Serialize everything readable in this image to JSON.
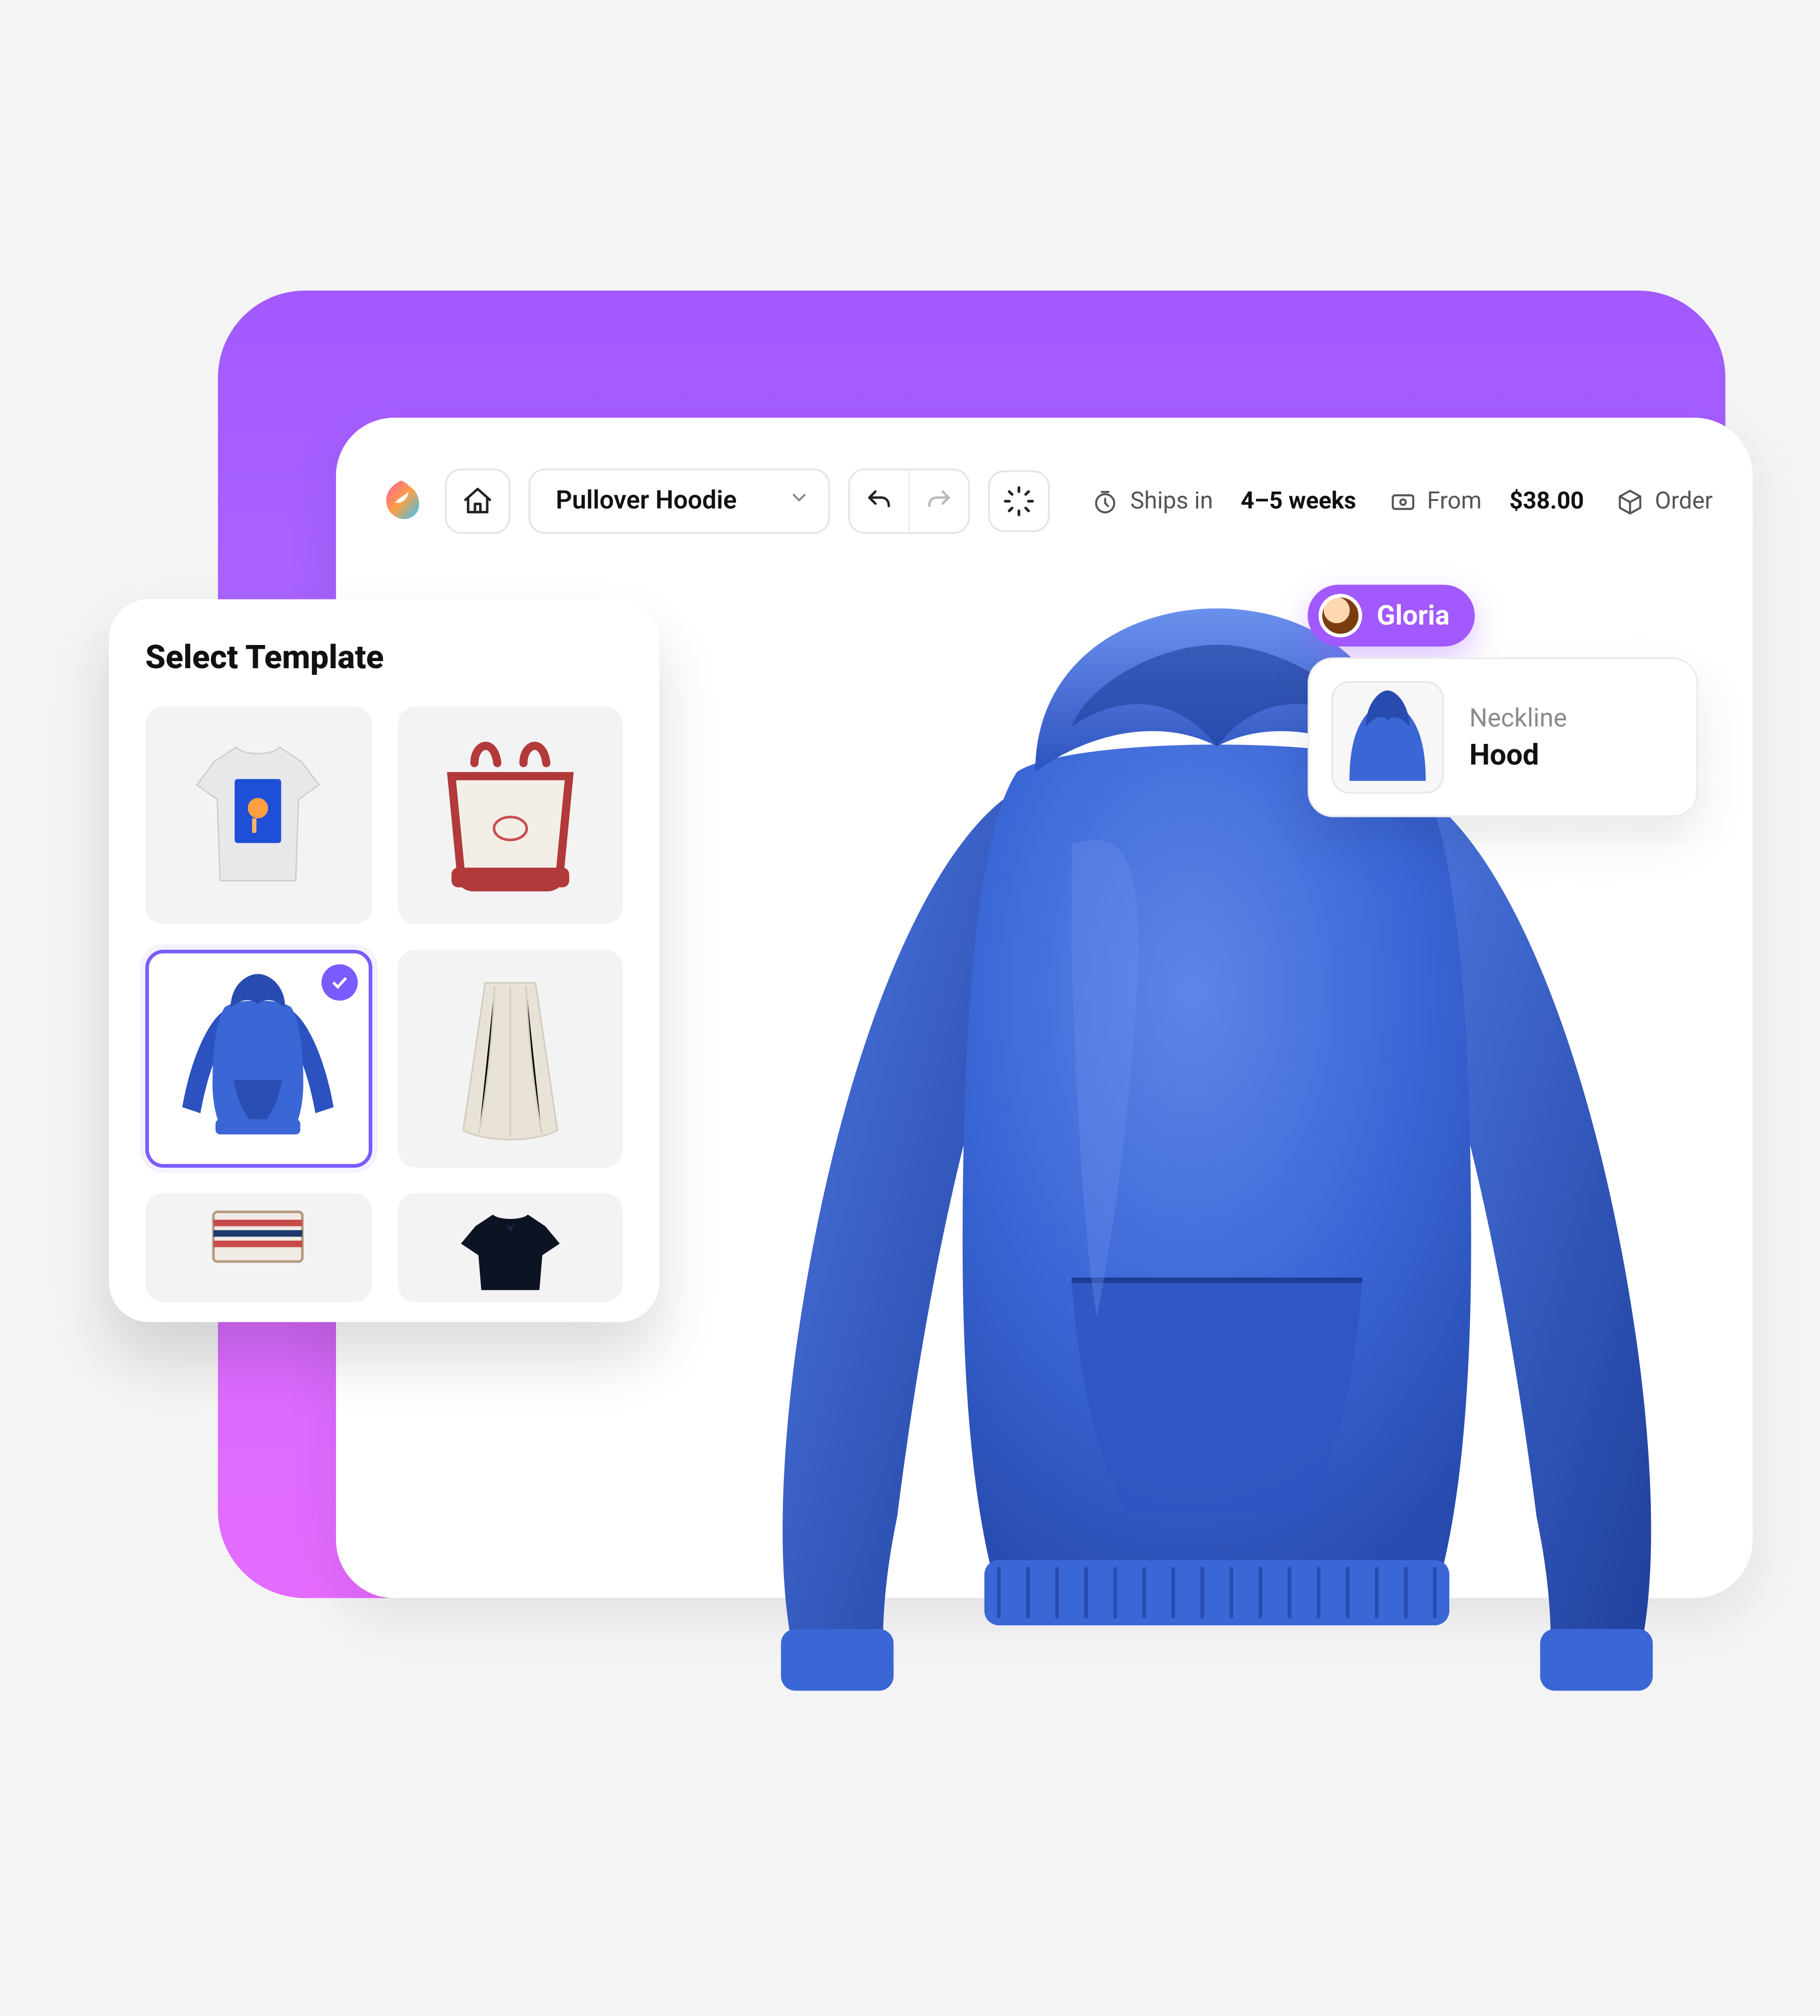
{
  "header": {
    "product_name": "Pullover Hoodie",
    "shipping_prefix": "Ships in",
    "shipping_value": "4–5 weeks",
    "price_prefix": "From",
    "price_value": "$38.00",
    "order_label": "Order"
  },
  "collaborator": {
    "name": "Gloria"
  },
  "option_card": {
    "label": "Neckline",
    "value": "Hood"
  },
  "template_panel": {
    "title": "Select Template",
    "items": [
      {
        "name": "tshirt",
        "selected": false
      },
      {
        "name": "tote-bag",
        "selected": false
      },
      {
        "name": "hoodie",
        "selected": true
      },
      {
        "name": "skirt",
        "selected": false
      },
      {
        "name": "rug",
        "selected": false
      },
      {
        "name": "polo",
        "selected": false
      }
    ]
  },
  "colors": {
    "accent_purple": "#A259FF",
    "accent_purple_alt": "#7B5BFF",
    "hoodie_blue": "#3A66D6",
    "hoodie_blue_dark": "#274BAF",
    "hoodie_blue_hi": "#5E86E8"
  }
}
